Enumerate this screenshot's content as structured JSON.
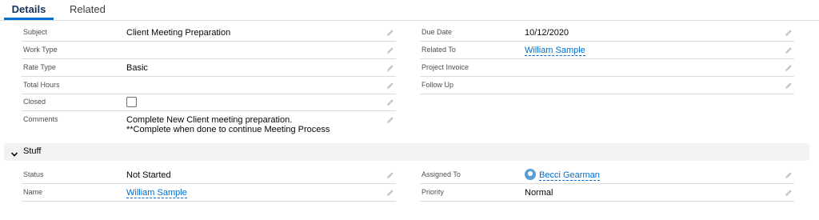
{
  "tabs": {
    "details": "Details",
    "related": "Related"
  },
  "fields": {
    "subject": {
      "label": "Subject",
      "value": "Client Meeting Preparation"
    },
    "work_type": {
      "label": "Work Type",
      "value": ""
    },
    "rate_type": {
      "label": "Rate Type",
      "value": "Basic"
    },
    "total_hours": {
      "label": "Total Hours",
      "value": ""
    },
    "closed": {
      "label": "Closed",
      "checked": false
    },
    "comments": {
      "label": "Comments",
      "line1": "Complete New Client meeting preparation.",
      "line2": "**Complete when done to continue Meeting Process"
    },
    "due_date": {
      "label": "Due Date",
      "value": "10/12/2020"
    },
    "related_to": {
      "label": "Related To",
      "value": "William Sample"
    },
    "project_invoice": {
      "label": "Project Invoice",
      "value": ""
    },
    "follow_up": {
      "label": "Follow Up",
      "value": ""
    }
  },
  "stuff_section": {
    "title": "Stuff",
    "status": {
      "label": "Status",
      "value": "Not Started"
    },
    "name": {
      "label": "Name",
      "value": "William Sample"
    },
    "assigned_to": {
      "label": "Assigned To",
      "value": "Becci Gearman"
    },
    "priority": {
      "label": "Priority",
      "value": "Normal"
    }
  },
  "icons": {
    "edit": "pencil-icon",
    "section_toggle": "chevron-down-icon",
    "user": "user-avatar-icon"
  },
  "colors": {
    "link": "#006dcc",
    "tab_active": "#0070d2",
    "divider": "#dddbda",
    "section_bg": "#f3f2f2"
  }
}
